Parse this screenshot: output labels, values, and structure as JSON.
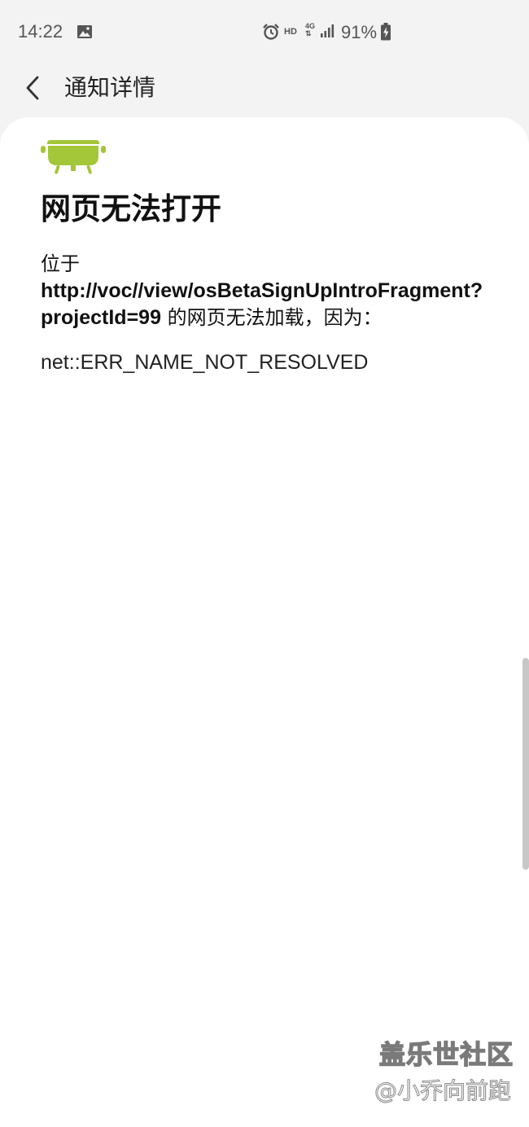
{
  "status_bar": {
    "time": "14:22",
    "hd": "HD",
    "network": "4G",
    "battery": "91%",
    "icons": [
      "gallery-icon",
      "alarm-icon",
      "signal-icon",
      "battery-charging-icon"
    ]
  },
  "app_bar": {
    "back_icon": "chevron-left-icon",
    "title": "通知详情"
  },
  "content": {
    "logo": "android-logo",
    "title": "网页无法打开",
    "body_prefix": "位于",
    "url": "http://voc//view/osBetaSignUpIntroFragment?",
    "project_id": "projectId=99",
    "body_suffix": " 的网页无法加载，因为：",
    "error_code": "net::ERR_NAME_NOT_RESOLVED"
  },
  "watermark": {
    "line1": "盖乐世社区",
    "line2": "@小乔向前跑"
  },
  "colors": {
    "android_green": "#a4c639",
    "background": "#f3f3f3",
    "card": "#ffffff"
  }
}
